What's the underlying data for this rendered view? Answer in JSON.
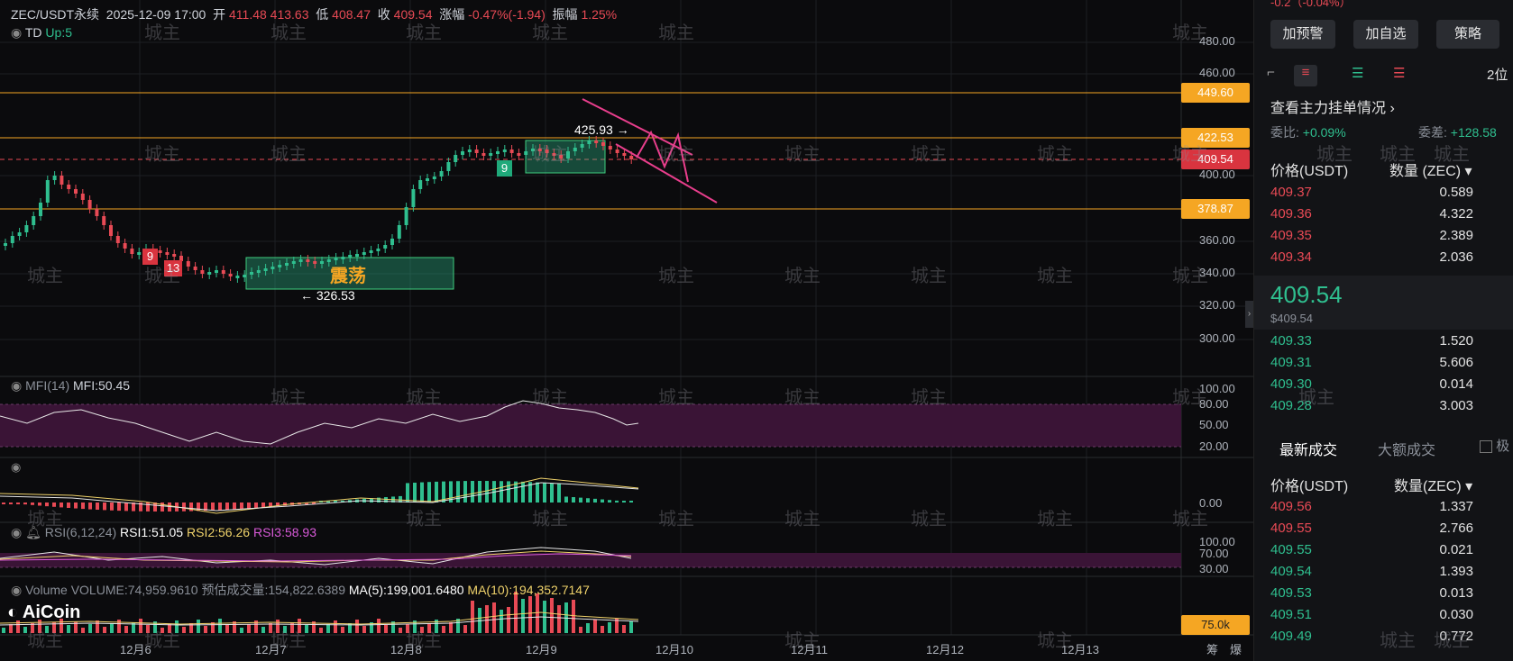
{
  "header": {
    "symbol": "ZEC/USDT永续",
    "datetime": "2025-12-09 17:00",
    "open_label": "开",
    "open": "411.48",
    "high": "413.63",
    "low_label": "低",
    "low": "408.47",
    "close_label": "收",
    "close": "409.54",
    "change_label": "涨幅",
    "change": "-0.47%(-1.94)",
    "amp_label": "振幅",
    "amp": "1.25%",
    "indicator_name": "TD",
    "indicator_value": "Up:5"
  },
  "price_axis": [
    "480.00",
    "460.00",
    "449.60",
    "422.53",
    "409.54",
    "400.00",
    "378.87",
    "360.00",
    "340.00",
    "320.00",
    "300.00"
  ],
  "tags": {
    "t1": "449.60",
    "t2": "422.53",
    "t3": "409.54",
    "t4": "378.87",
    "vol": "75.0k"
  },
  "annotations": {
    "high": "425.93",
    "low": "← 326.53",
    "box_label": "震荡",
    "td9a": "9",
    "td13": "13",
    "td9b": "9"
  },
  "mfi": {
    "label": "MFI(14)",
    "value": "MFI:50.45",
    "axis": [
      "100.00",
      "80.00",
      "50.00",
      "20.00"
    ]
  },
  "macd": {
    "axis": "0.00"
  },
  "rsi": {
    "label": "RSI(6,12,24)",
    "r1": "RSI1:51.05",
    "r2": "RSI2:56.26",
    "r3": "RSI3:58.93",
    "axis": [
      "100.00",
      "70.00",
      "30.00"
    ]
  },
  "volume": {
    "label": "Volume",
    "vol": "VOLUME:74,959.9610",
    "est": "预估成交量:154,822.6389",
    "ma5": "MA(5):199,001.6480",
    "ma10": "MA(10):194,352.7147"
  },
  "x_axis": [
    "12月6",
    "12月7",
    "12月8",
    "12月9",
    "12月10",
    "12月11",
    "12月12",
    "12月13"
  ],
  "bottom_right": {
    "a": "筹",
    "b": "爆"
  },
  "logo": "AiCoin",
  "watermark": "城主",
  "panel": {
    "top_cut": "-0.2（-0.04%）",
    "btn_alert": "加预警",
    "btn_fav": "加自选",
    "btn_strategy": "策略",
    "depth_label": "2位",
    "orders_link": "查看主力挂单情况 ›",
    "ratio_label": "委比:",
    "ratio": "+0.09%",
    "diff_label": "委差:",
    "diff": "+128.58",
    "col_price": "价格(USDT)",
    "col_qty": "数量 (ZEC) ▾",
    "asks": [
      [
        "409.37",
        "0.589"
      ],
      [
        "409.36",
        "4.322"
      ],
      [
        "409.35",
        "2.389"
      ],
      [
        "409.34",
        "2.036"
      ]
    ],
    "last_price": "409.54",
    "last_usd": "$409.54",
    "bids": [
      [
        "409.33",
        "1.520"
      ],
      [
        "409.31",
        "5.606"
      ],
      [
        "409.30",
        "0.014"
      ],
      [
        "409.28",
        "3.003"
      ]
    ],
    "tab_latest": "最新成交",
    "tab_large": "大额成交",
    "tab_extra": "极",
    "col_price2": "价格(USDT)",
    "col_qty2": "数量(ZEC) ▾",
    "trades": [
      [
        "409.56",
        "1.337",
        "red"
      ],
      [
        "409.55",
        "2.766",
        "red"
      ],
      [
        "409.55",
        "0.021",
        "green"
      ],
      [
        "409.54",
        "1.393",
        "green"
      ],
      [
        "409.53",
        "0.013",
        "green"
      ],
      [
        "409.51",
        "0.030",
        "green"
      ],
      [
        "409.49",
        "0.772",
        "green"
      ]
    ]
  },
  "colors": {
    "up": "#2fbf8f",
    "down": "#e84a55",
    "level": "#f5a623",
    "trend": "#e83e8c"
  }
}
